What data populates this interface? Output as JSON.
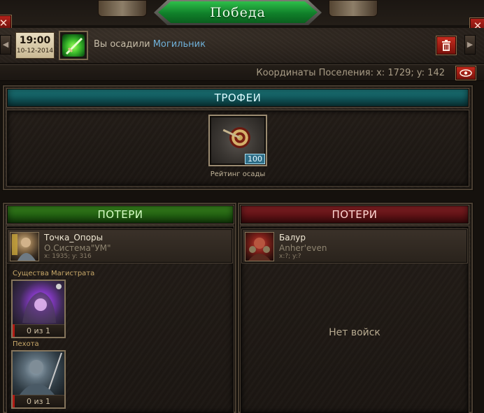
{
  "window": {
    "title": "Победа",
    "close_glyph": "✕"
  },
  "report": {
    "time": "19:00",
    "date": "10-12-2014",
    "event_prefix": "Вы осадили",
    "event_target": "Могильник",
    "icon": "siege-sword-icon",
    "coords_text": "Координаты Поселения: x: 1729; y: 142"
  },
  "navigation": {
    "prev_glyph": "◀",
    "next_glyph": "▶",
    "delete_glyph": "🗑",
    "eye_glyph": "👁"
  },
  "trophies": {
    "header": "ТРОФЕИ",
    "item_icon": "siege-target-icon",
    "item_count": "100",
    "item_label": "Рейтинг осады"
  },
  "losses_left": {
    "header": "ПОТЕРИ",
    "player": {
      "name": "Точка_Опоры",
      "guild": "О.Система\"УМ\"",
      "coords": "x: 1935; y: 316"
    },
    "groups": [
      {
        "label": "Существа Магистрата",
        "count": "0 из 1"
      },
      {
        "label": "Пехота",
        "count": "0 из 1"
      }
    ]
  },
  "losses_right": {
    "header": "ПОТЕРИ",
    "player": {
      "name": "Балур",
      "guild": "Anher'even",
      "coords": "x:?; y:?"
    },
    "empty_text": "Нет войск"
  },
  "colors": {
    "victory_green": "#10802a",
    "trophy_teal": "#0f4f53",
    "loss_green": "#1f5a10",
    "loss_red": "#5a1114",
    "link_blue": "#6fb0d8"
  }
}
